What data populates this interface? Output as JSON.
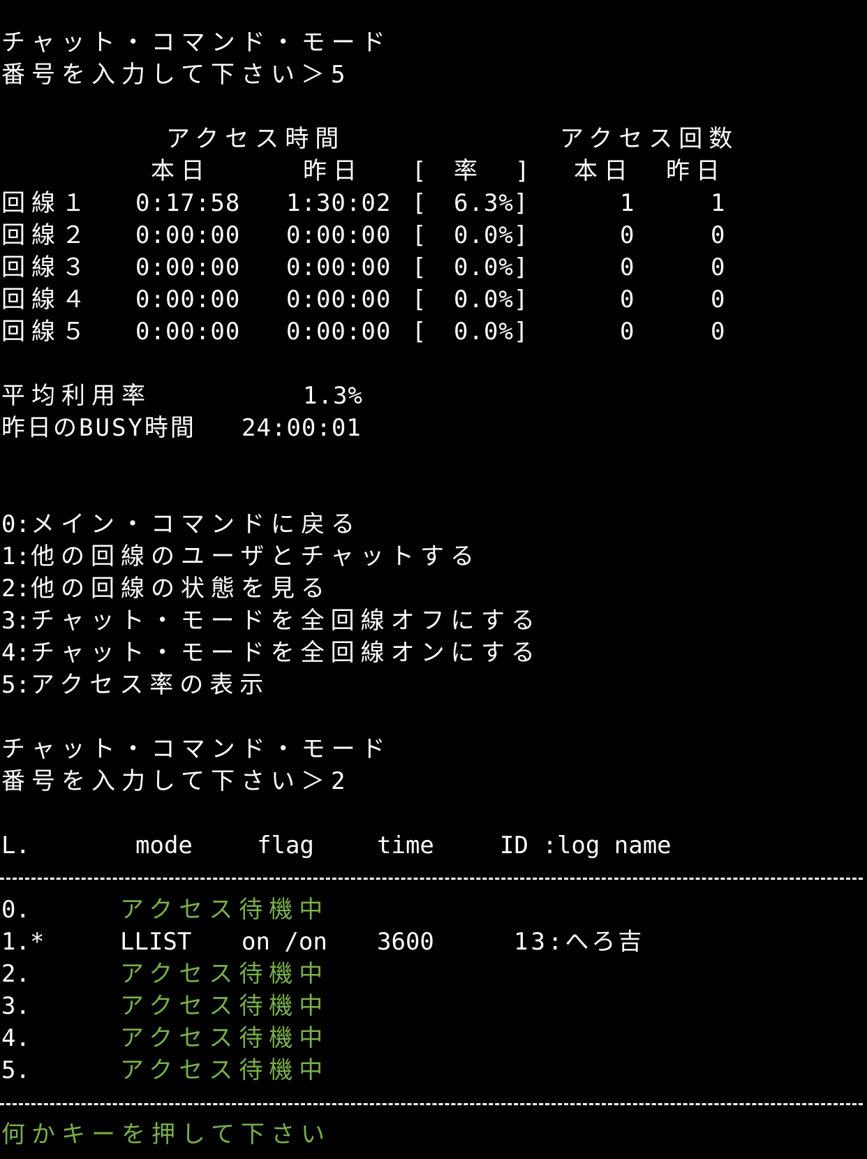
{
  "mode_title_1": "チャット・コマンド・モード",
  "prompt_1": "番号を入力して下さい＞5",
  "access_stats": {
    "header_access_time": "アクセス時間",
    "header_access_count": "アクセス回数",
    "col_today": "本日",
    "col_yesterday": "昨日",
    "col_rate_open": "[",
    "col_rate": "率",
    "col_rate_close": "]",
    "col_count_today": "本日",
    "col_count_yesterday": "昨日",
    "rows": [
      {
        "line": "回線１",
        "today": "0:17:58",
        "yesterday": "1:30:02",
        "bracket": "[",
        "rate": "6.3%]",
        "count_today": "1",
        "count_yesterday": "1"
      },
      {
        "line": "回線２",
        "today": "0:00:00",
        "yesterday": "0:00:00",
        "bracket": "[",
        "rate": "0.0%]",
        "count_today": "0",
        "count_yesterday": "0"
      },
      {
        "line": "回線３",
        "today": "0:00:00",
        "yesterday": "0:00:00",
        "bracket": "[",
        "rate": "0.0%]",
        "count_today": "0",
        "count_yesterday": "0"
      },
      {
        "line": "回線４",
        "today": "0:00:00",
        "yesterday": "0:00:00",
        "bracket": "[",
        "rate": "0.0%]",
        "count_today": "0",
        "count_yesterday": "0"
      },
      {
        "line": "回線５",
        "today": "0:00:00",
        "yesterday": "0:00:00",
        "bracket": "[",
        "rate": "0.0%]",
        "count_today": "0",
        "count_yesterday": "0"
      }
    ],
    "avg_label": "平均利用率",
    "avg_value": "1.3%",
    "busy_label": "昨日のBUSY時間",
    "busy_value": "24:00:01"
  },
  "menu": [
    {
      "key": "0:",
      "label": "メイン・コマンドに戻る"
    },
    {
      "key": "1:",
      "label": "他の回線のユーザとチャットする"
    },
    {
      "key": "2:",
      "label": "他の回線の状態を見る"
    },
    {
      "key": "3:",
      "label": "チャット・モードを全回線オフにする"
    },
    {
      "key": "4:",
      "label": "チャット・モードを全回線オンにする"
    },
    {
      "key": "5:",
      "label": "アクセス率の表示"
    }
  ],
  "mode_title_2": "チャット・コマンド・モード",
  "prompt_2": "番号を入力して下さい＞2",
  "line_status": {
    "headers": {
      "line": "L.",
      "mode": "mode",
      "flag": "flag",
      "time": "time",
      "id_log": "ID :log name"
    },
    "rows": [
      {
        "line": "0.",
        "mode": "アクセス待機中",
        "flag": "",
        "time": "",
        "id_log": ""
      },
      {
        "line": "1.*",
        "mode": "LLIST",
        "flag": "on /on",
        "time": "3600",
        "id_log": "13:へろ吉"
      },
      {
        "line": "2.",
        "mode": "アクセス待機中",
        "flag": "",
        "time": "",
        "id_log": ""
      },
      {
        "line": "3.",
        "mode": "アクセス待機中",
        "flag": "",
        "time": "",
        "id_log": ""
      },
      {
        "line": "4.",
        "mode": "アクセス待機中",
        "flag": "",
        "time": "",
        "id_log": ""
      },
      {
        "line": "5.",
        "mode": "アクセス待機中",
        "flag": "",
        "time": "",
        "id_log": ""
      }
    ]
  },
  "press_key": "何かキーを押して下さい",
  "colors": {
    "background": "#000000",
    "text": "#ffffff",
    "accent_green": "#78b04a"
  }
}
